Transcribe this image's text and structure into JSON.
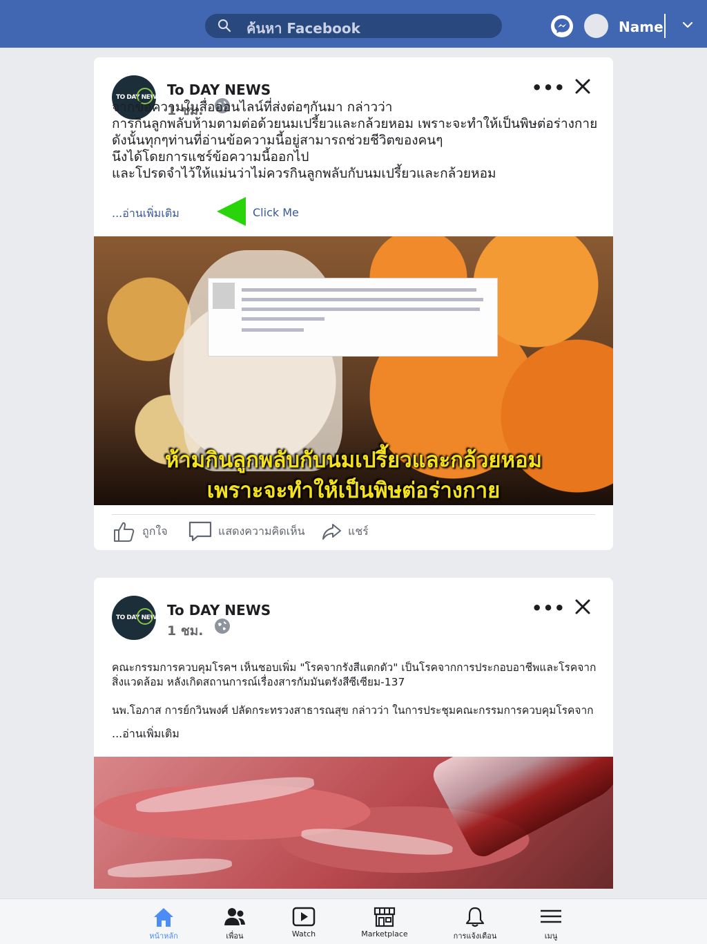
{
  "topbar": {
    "search_placeholder": "ค้นหา Facebook",
    "user_name": "Name",
    "brand_color": "#4267b2"
  },
  "posts": [
    {
      "page_name": "To DAY NEWS",
      "time": "1 ชม.",
      "avatar_text": "TO DAY NEWS",
      "text_lines": [
        "จากข้อความในสื่อออนไลน์ที่ส่งต่อๆกันมา กล่าวว่า",
        "การกินลูกพลับห้ามตามต่อด้วยนมเปรี้ยวและกล้วยหอม เพราะจะทำให้เป็นพิษต่อร่างกาย",
        "ดังนั้นทุกๆท่านที่อ่านข้อความนี้อยู่สามารถช่วยชีวิตของคนๆ",
        "นึงได้โดยการแชร์ข้อความนี้ออกไป",
        "และโปรดจำไว้ให้แม่นว่าไม่ควรกินลูกพลับกับนมเปรี้ยวและกล้วยหอม"
      ],
      "read_more": "...อ่านเพิ่มเติม",
      "click_me": "Click Me",
      "image_caption_1": "ห้ามกินลูกพลับกับนมเปรี้ยวและกล้วยหอม",
      "image_caption_2": "เพราะจะทำให้เป็นพิษต่อร่างกาย",
      "actions": {
        "like": "ถูกใจ",
        "comment": "แสดงความคิดเห็น",
        "share": "แชร์"
      }
    },
    {
      "page_name": "To DAY NEWS",
      "time": "1 ชม.",
      "avatar_text": "TO DAY NEWS",
      "paragraph_1_line_1": "คณะกรรมการควบคุมโรคฯ เห็นชอบเพิ่ม \"โรคจากรังสีแตกตัว\" เป็นโรคจากการประกอบอาชีพและโรคจาก",
      "paragraph_1_line_2": "สิ่งแวดล้อม หลังเกิดสถานการณ์เรื่องสารกัมมันตรังสีซีเซียม-137",
      "paragraph_2": "นพ.โอภาส การย์กวินพงศ์ ปลัดกระทรวงสาธารณสุข กล่าวว่า ในการประชุมคณะกรรมการควบคุมโรคจาก",
      "read_more": "...อ่านเพิ่มเติม"
    }
  ],
  "bottom_nav": [
    {
      "label": "หน้าหลัก",
      "icon": "home-icon",
      "active": true
    },
    {
      "label": "เพื่อน",
      "icon": "friends-icon",
      "active": false
    },
    {
      "label": "Watch",
      "icon": "watch-icon",
      "active": false
    },
    {
      "label": "Marketplace",
      "icon": "marketplace-icon",
      "active": false
    },
    {
      "label": "การแจ้งเตือน",
      "icon": "bell-icon",
      "active": false
    },
    {
      "label": "เมนู",
      "icon": "menu-icon",
      "active": false
    }
  ],
  "colors": {
    "accent": "#4b8cf5",
    "arrow": "#2ad40a",
    "caption_yellow": "#f5e21b"
  }
}
